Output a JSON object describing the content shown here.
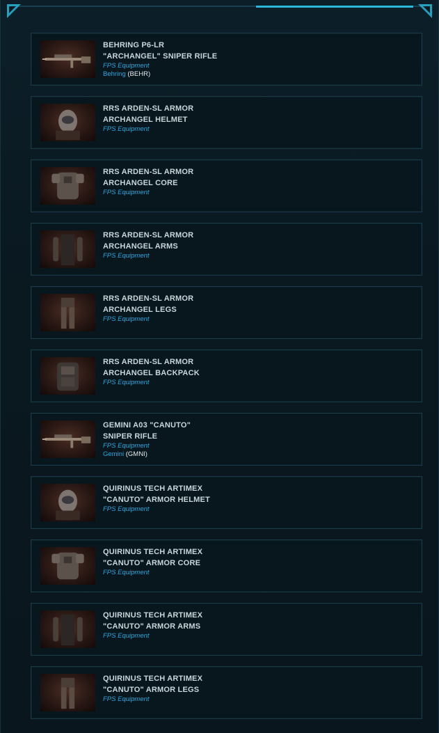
{
  "items": [
    {
      "title": "BEHRING P6-LR\n\"ARCHANGEL\" SNIPER RIFLE",
      "category": "FPS Equipment",
      "maker_name": "Behring",
      "maker_code": " (BEHR)",
      "icon": "sniper-rifle-icon"
    },
    {
      "title": "RRS ARDEN-SL ARMOR\nARCHANGEL HELMET",
      "category": "FPS Equipment",
      "icon": "helmet-icon"
    },
    {
      "title": "RRS ARDEN-SL ARMOR\nARCHANGEL CORE",
      "category": "FPS Equipment",
      "icon": "armor-core-icon"
    },
    {
      "title": "RRS ARDEN-SL ARMOR\nARCHANGEL ARMS",
      "category": "FPS Equipment",
      "icon": "armor-arms-icon"
    },
    {
      "title": "RRS ARDEN-SL ARMOR\nARCHANGEL LEGS",
      "category": "FPS Equipment",
      "icon": "armor-legs-icon"
    },
    {
      "title": "RRS ARDEN-SL ARMOR\nARCHANGEL BACKPACK",
      "category": "FPS Equipment",
      "icon": "backpack-icon"
    },
    {
      "title": "GEMINI A03 \"CANUTO\"\nSNIPER RIFLE",
      "category": "FPS Equipment",
      "maker_name": "Gemini",
      "maker_code": " (GMNI)",
      "icon": "sniper-rifle-icon"
    },
    {
      "title": "QUIRINUS TECH ARTIMEX\n\"CANUTO\" ARMOR HELMET",
      "category": "FPS Equipment",
      "icon": "helmet-icon"
    },
    {
      "title": "QUIRINUS TECH ARTIMEX\n\"CANUTO\" ARMOR CORE",
      "category": "FPS Equipment",
      "icon": "armor-core-icon"
    },
    {
      "title": "QUIRINUS TECH ARTIMEX\n\"CANUTO\" ARMOR ARMS",
      "category": "FPS Equipment",
      "icon": "armor-arms-icon"
    },
    {
      "title": "QUIRINUS TECH ARTIMEX\n\"CANUTO\" ARMOR LEGS",
      "category": "FPS Equipment",
      "icon": "armor-legs-icon"
    }
  ],
  "colors": {
    "accent": "#29b8d9",
    "category": "#27a8e0",
    "title": "#c9d6dc",
    "panel_border": "#1b3a48"
  }
}
